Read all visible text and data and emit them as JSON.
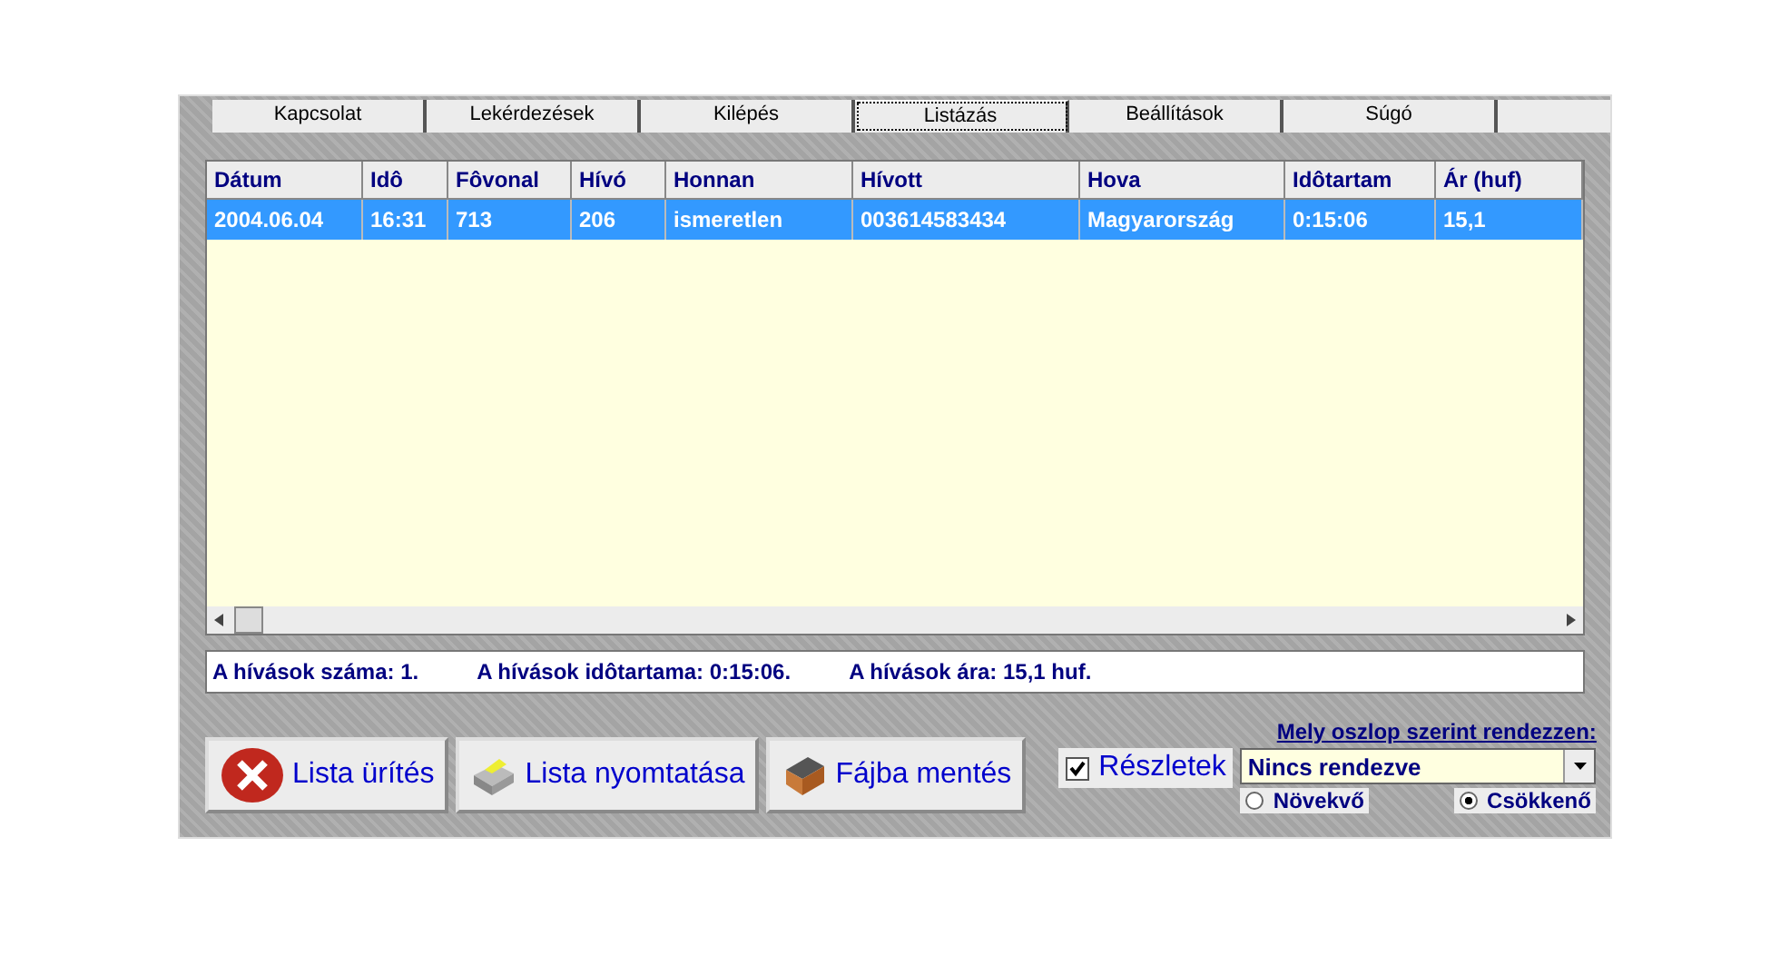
{
  "tabs": [
    {
      "label": "Kapcsolat",
      "selected": false
    },
    {
      "label": "Lekérdezések",
      "selected": false
    },
    {
      "label": "Kilépés",
      "selected": false
    },
    {
      "label": "Listázás",
      "selected": true
    },
    {
      "label": "Beállítások",
      "selected": false
    },
    {
      "label": "Súgó",
      "selected": false
    }
  ],
  "table": {
    "columns": [
      "Dátum",
      "Idô",
      "Fôvonal",
      "Hívó",
      "Honnan",
      "Hívott",
      "Hova",
      "Idôtartam",
      "Ár (huf)"
    ],
    "rows": [
      {
        "cells": [
          "2004.06.04",
          "16:31",
          "713",
          "206",
          "ismeretlen",
          "003614583434",
          "Magyarország",
          "0:15:06",
          "15,1"
        ],
        "selected": true
      }
    ]
  },
  "summary": [
    "A hívások száma: 1.",
    "A hívások idôtartama: 0:15:06.",
    "A hívások ára: 15,1 huf."
  ],
  "buttons": [
    {
      "label": "Lista ürítés",
      "kind": "clear"
    },
    {
      "label": "Lista nyomtatása",
      "kind": "print"
    },
    {
      "label": "Fájba mentés",
      "kind": "save"
    }
  ],
  "details": {
    "label": "Részletek",
    "checked": true
  },
  "sort": {
    "label": "Mely oszlop szerint rendezzen:",
    "value": "Nincs rendezve",
    "options": [
      {
        "label": "Növekvő",
        "selected": false
      },
      {
        "label": "Csökkenő",
        "selected": true
      }
    ]
  }
}
